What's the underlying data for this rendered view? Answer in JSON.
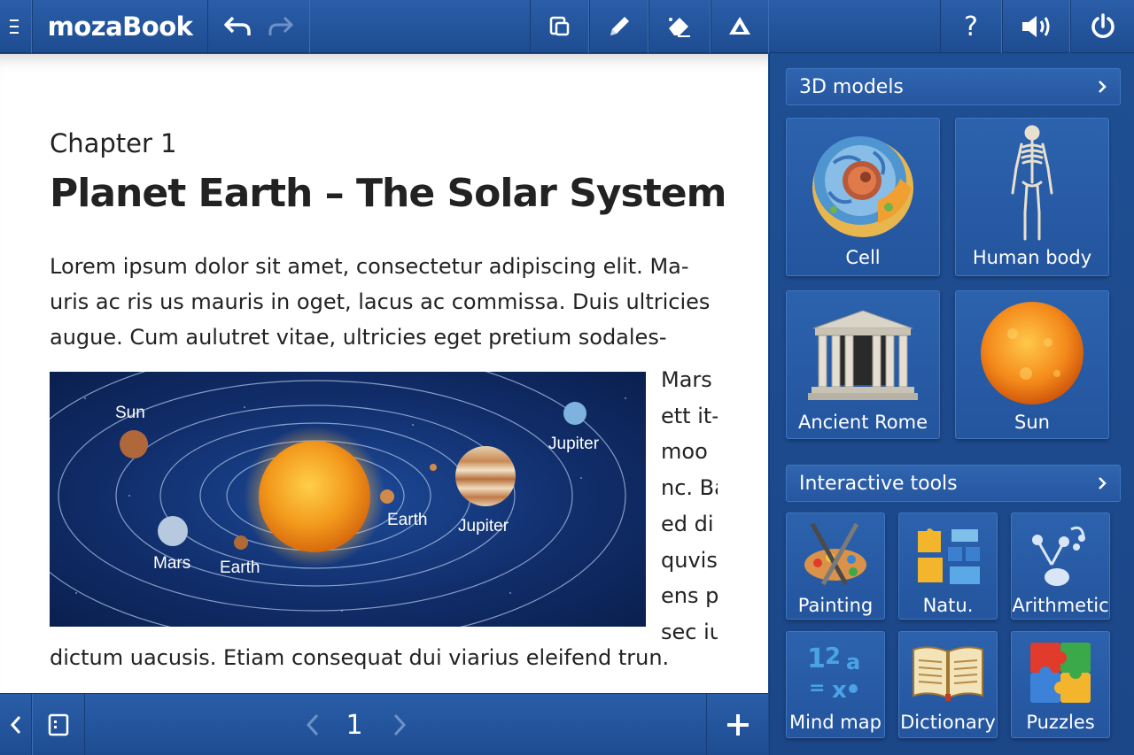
{
  "app": {
    "name": "mozaBook"
  },
  "toolbar": {
    "left_icons": [
      "menu-icon",
      "undo-icon",
      "redo-icon"
    ],
    "center_icons": [
      "copy-icon",
      "pen-icon",
      "eraser-icon",
      "triangle-tool-icon"
    ],
    "right_icons": [
      "help-icon",
      "volume-icon",
      "power-icon"
    ],
    "help_label": "?"
  },
  "page": {
    "chapter": "Chapter 1",
    "title": "Planet Earth – The Solar System",
    "para_lines": [
      "Lorem ipsum dolor sit amet, consectetur adipiscing elit. Ma-",
      "uris ac ris us mauris in oget, lacus ac commissa. Duis ultricies",
      "augue. Cum aulutret vitae, ultricies eget pretium sodales-"
    ],
    "side_lines": [
      "Mars",
      "ett it-",
      "moo",
      "nc. Ba",
      "ed di",
      "quvis",
      "ens p",
      "sec iu"
    ],
    "bottom_line": "dictum uacusis. Etiam consequat dui viarius eleifend trun.",
    "image_labels": {
      "sun": "Sun",
      "jupiter_top": "Jupiter",
      "earth_right": "Earth",
      "jupiter_bottom": "Jupiter",
      "mars": "Mars",
      "earth_bottom": "Earth"
    }
  },
  "bottombar": {
    "page_number": "1",
    "icons": [
      "collapse-left-icon",
      "page-view-icon",
      "prev-page-icon",
      "next-page-icon",
      "add-page-icon"
    ]
  },
  "panel": {
    "models": {
      "heading": "3D models",
      "tiles": [
        {
          "label": "Cell",
          "icon": "cell-icon"
        },
        {
          "label": "Human body",
          "icon": "skeleton-icon"
        },
        {
          "label": "Ancient Rome",
          "icon": "temple-icon"
        },
        {
          "label": "Sun",
          "icon": "sun-icon"
        }
      ]
    },
    "tools": {
      "heading": "Interactive tools",
      "tiles": [
        {
          "label": "Painting",
          "icon": "palette-icon"
        },
        {
          "label": "Natu.",
          "icon": "puzzle-blocks-icon"
        },
        {
          "label": "Arithmetic",
          "icon": "nodes-icon"
        },
        {
          "label": "Mind map",
          "icon": "numbers-icon"
        },
        {
          "label": "Dictionary",
          "icon": "book-icon"
        },
        {
          "label": "Puzzles",
          "icon": "jigsaw-icon"
        }
      ]
    }
  }
}
